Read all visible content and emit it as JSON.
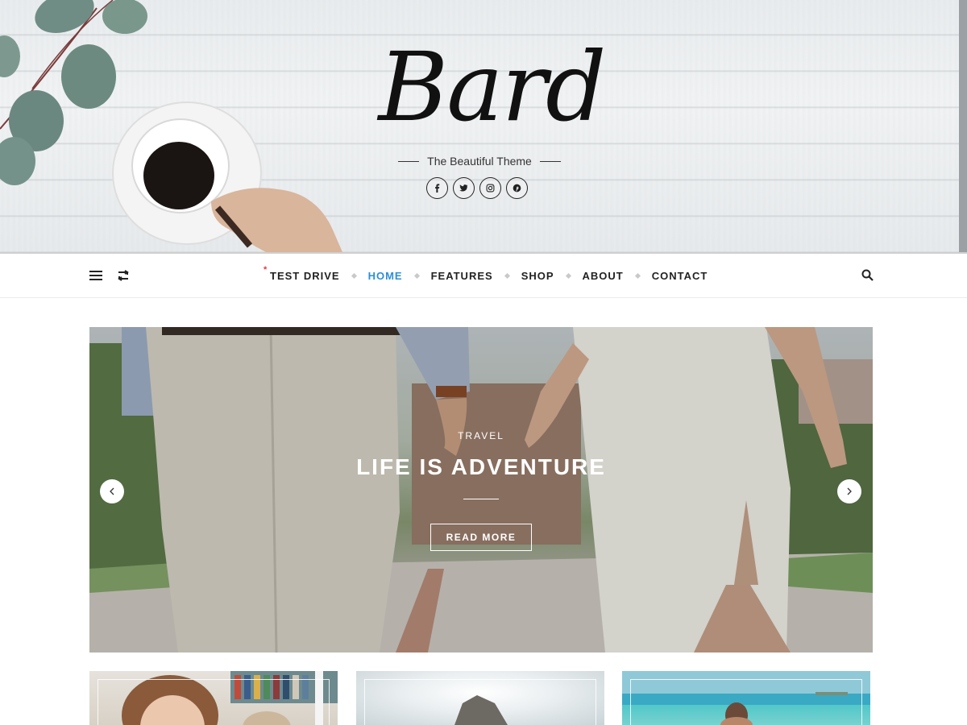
{
  "header": {
    "logo": "Bard",
    "tagline": "The Beautiful Theme",
    "socials": [
      {
        "icon": "facebook-icon"
      },
      {
        "icon": "twitter-icon"
      },
      {
        "icon": "instagram-icon"
      },
      {
        "icon": "pinterest-icon"
      }
    ]
  },
  "nav": {
    "left_icons": [
      "menu-icon",
      "random-icon"
    ],
    "items": [
      {
        "label": "TEST DRIVE"
      },
      {
        "label": "HOME"
      },
      {
        "label": "FEATURES"
      },
      {
        "label": "SHOP"
      },
      {
        "label": "ABOUT"
      },
      {
        "label": "CONTACT"
      }
    ],
    "active_item": "HOME",
    "test_drive_marker": "*",
    "search_icon": "search-icon"
  },
  "slider": {
    "category": "TRAVEL",
    "title": "LIFE IS ADVENTURE",
    "button": "READ MORE",
    "prev_icon": "chevron-left-icon",
    "next_icon": "chevron-right-icon"
  },
  "colors": {
    "accent": "#2c8fd6",
    "marker": "#e23b3b"
  }
}
